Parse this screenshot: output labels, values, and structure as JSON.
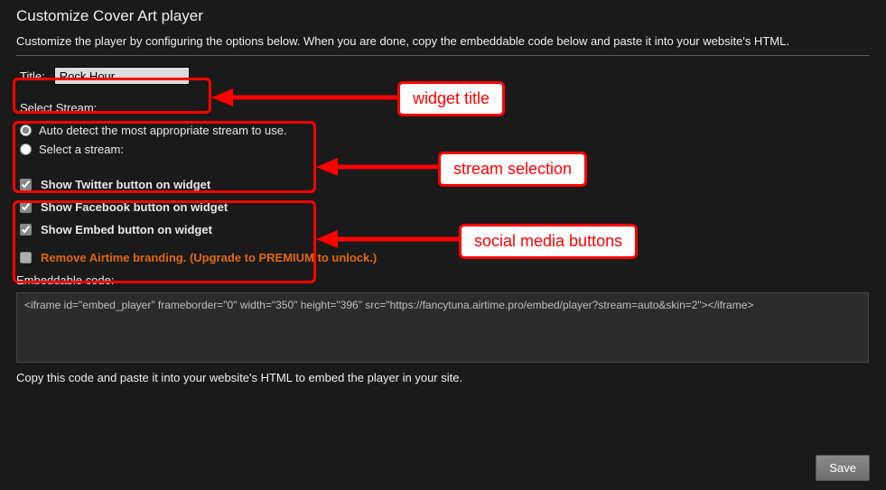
{
  "page": {
    "title": "Customize Cover Art player",
    "subtitle": "Customize the player by configuring the options below. When you are done, copy the embeddable code below and paste it into your website's HTML."
  },
  "titleField": {
    "label": "Title:",
    "value": "Rock Hour"
  },
  "stream": {
    "label": "Select Stream:",
    "options": {
      "auto": "Auto detect the most appropriate stream to use.",
      "select": "Select a stream:"
    },
    "selected": "auto"
  },
  "social": {
    "twitter": "Show Twitter button on widget",
    "facebook": "Show Facebook button on widget",
    "embed": "Show Embed button on widget",
    "premium": "Remove Airtime branding. (Upgrade to PREMIUM to unlock.)"
  },
  "embed": {
    "label": "Embeddable code:",
    "code": "<iframe id=\"embed_player\" frameborder=\"0\" width=\"350\" height=\"396\" src=\"https://fancytuna.airtime.pro/embed/player?stream=auto&skin=2\"></iframe>",
    "note": "Copy this code and paste it into your website's HTML to embed the player in your site."
  },
  "buttons": {
    "save": "Save"
  },
  "annotations": {
    "widget_title": "widget title",
    "stream_selection": "stream selection",
    "social_buttons": "social media buttons"
  }
}
